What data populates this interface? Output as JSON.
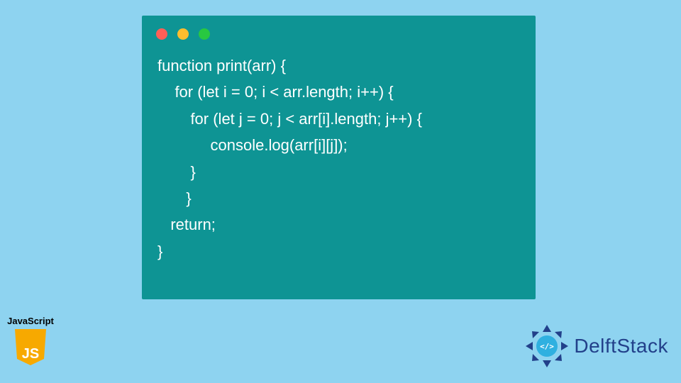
{
  "code": {
    "lines": [
      "function print(arr) {",
      "    for (let i = 0; i < arr.length; i++) {",
      "     for (let j = 0; j < arr[i].length; j++) {",
      "       console.log(arr[i][j]);",
      "     }",
      "    }",
      "   return;",
      "}"
    ]
  },
  "jsBadge": {
    "label": "JavaScript",
    "iconText": "JS"
  },
  "brand": {
    "name": "DelftStack"
  },
  "colors": {
    "background": "#8ed3f0",
    "codeWindow": "#0e9494",
    "jsShield": "#f7a900",
    "brandText": "#22408a"
  }
}
